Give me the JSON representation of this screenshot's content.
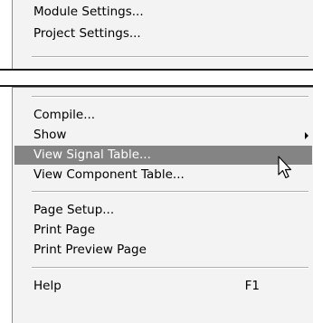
{
  "top_menu": {
    "items": [
      {
        "label": "Module Settings..."
      },
      {
        "label": "Project Settings..."
      }
    ]
  },
  "bottom_menu": {
    "items": [
      {
        "label": "Compile..."
      },
      {
        "label": "Show",
        "submenu": true
      },
      {
        "label": "View Signal Table...",
        "highlighted": true
      },
      {
        "label": "View Component Table..."
      },
      {
        "label": "Page Setup..."
      },
      {
        "label": "Print Page"
      },
      {
        "label": "Print Preview Page"
      },
      {
        "label": "Help",
        "shortcut": "F1"
      }
    ]
  },
  "colors": {
    "menu_background": "#f3f3f3",
    "highlight_background": "#848484",
    "highlight_text": "#ffffff"
  },
  "icons": {
    "submenu_arrow": "chevron-right-icon",
    "pointer": "mouse-cursor-icon"
  }
}
